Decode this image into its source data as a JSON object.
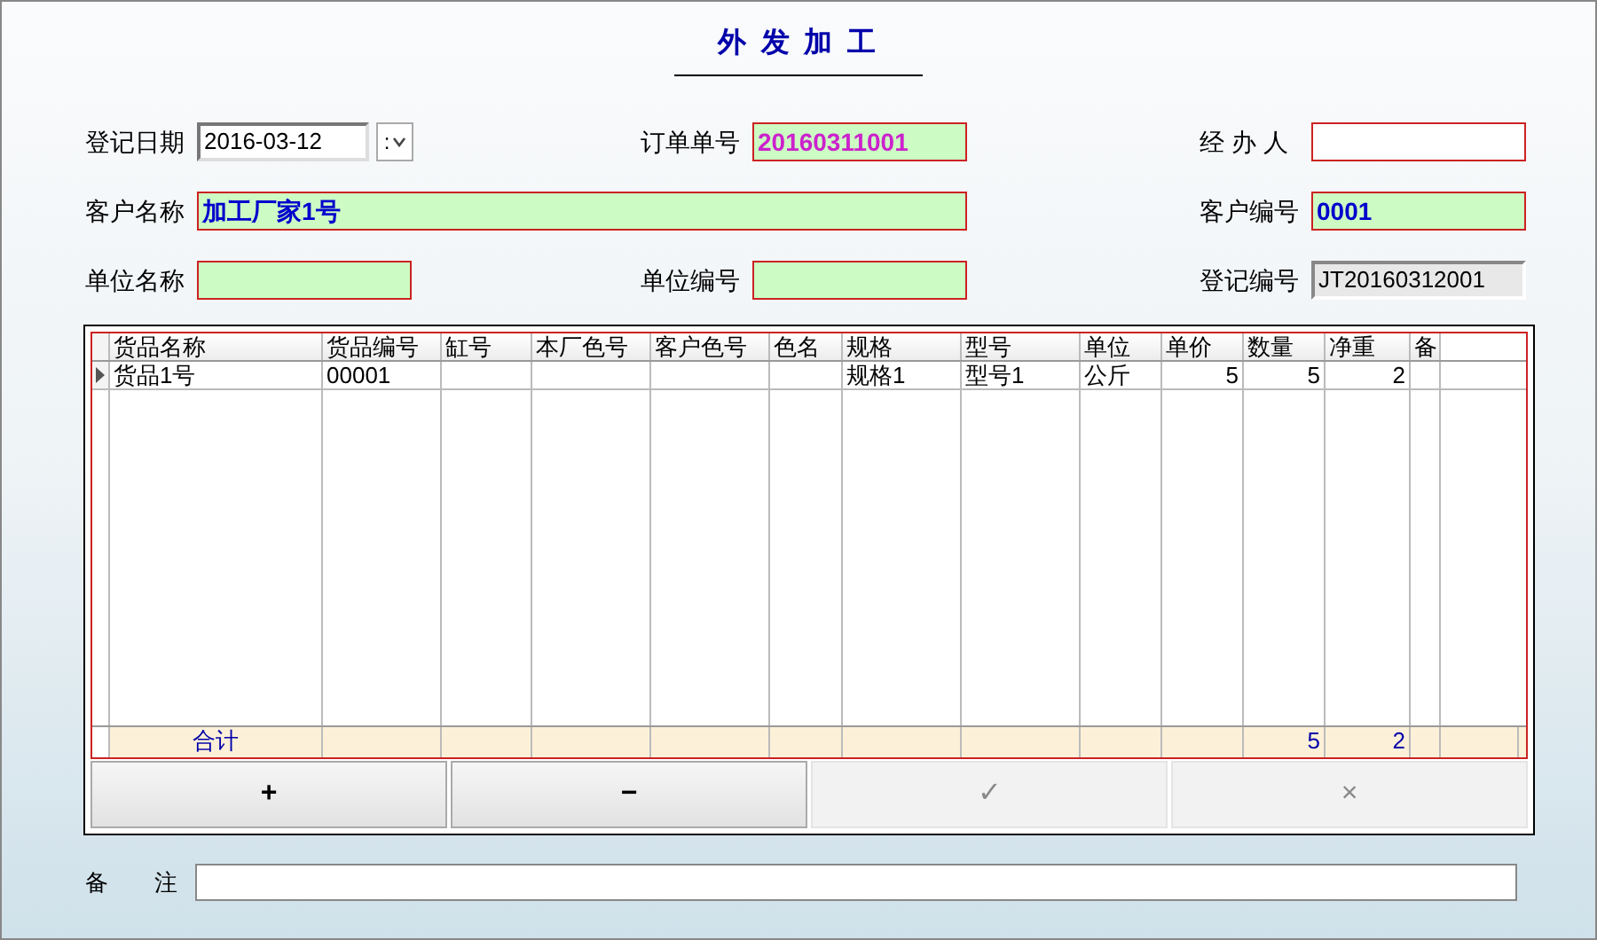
{
  "title": "外 发 加 工",
  "form_rows": [
    [
      {
        "label": "登记日期",
        "kind": "date",
        "value": "2016-03-12",
        "dropdown_text": ":"
      },
      {
        "label": "订单单号",
        "kind": "required",
        "value": "20160311001",
        "color": "#cc22cc"
      },
      {
        "label": "经 办 人",
        "kind": "plain"
      }
    ],
    [
      {
        "label": "客户名称",
        "kind": "required_wide",
        "value": "加工厂家1号",
        "color": "#0000cc"
      },
      {
        "label": "客户编号",
        "kind": "required",
        "value": "0001",
        "color": "#0000cc"
      }
    ],
    [
      {
        "label": "单位名称",
        "kind": "required"
      },
      {
        "label": "单位编号",
        "kind": "required"
      },
      {
        "label": "登记编号",
        "kind": "readonly",
        "value": "JT20160312001"
      }
    ]
  ],
  "table": {
    "columns": [
      "货品名称",
      "货品编号",
      "缸号",
      "本厂色号",
      "客户色号",
      "色名",
      "规格",
      "型号",
      "单位",
      "单价",
      "数量",
      "净重",
      "备"
    ],
    "rows": [
      {
        "selected": true,
        "cells": [
          "货品1号",
          "00001",
          null,
          null,
          null,
          null,
          "规格1",
          "型号1",
          "公斤",
          "5",
          "5",
          "2",
          null
        ]
      }
    ],
    "footer": {
      "label": "合计",
      "quantity_total": "5",
      "net_weight_total": "2"
    }
  },
  "buttons": [
    {
      "label": "+",
      "disabled": false
    },
    {
      "label": "−",
      "disabled": false
    },
    {
      "label": "✓",
      "disabled": true
    },
    {
      "label": "×",
      "disabled": true
    }
  ],
  "remarks": {
    "label": "备　　注"
  }
}
